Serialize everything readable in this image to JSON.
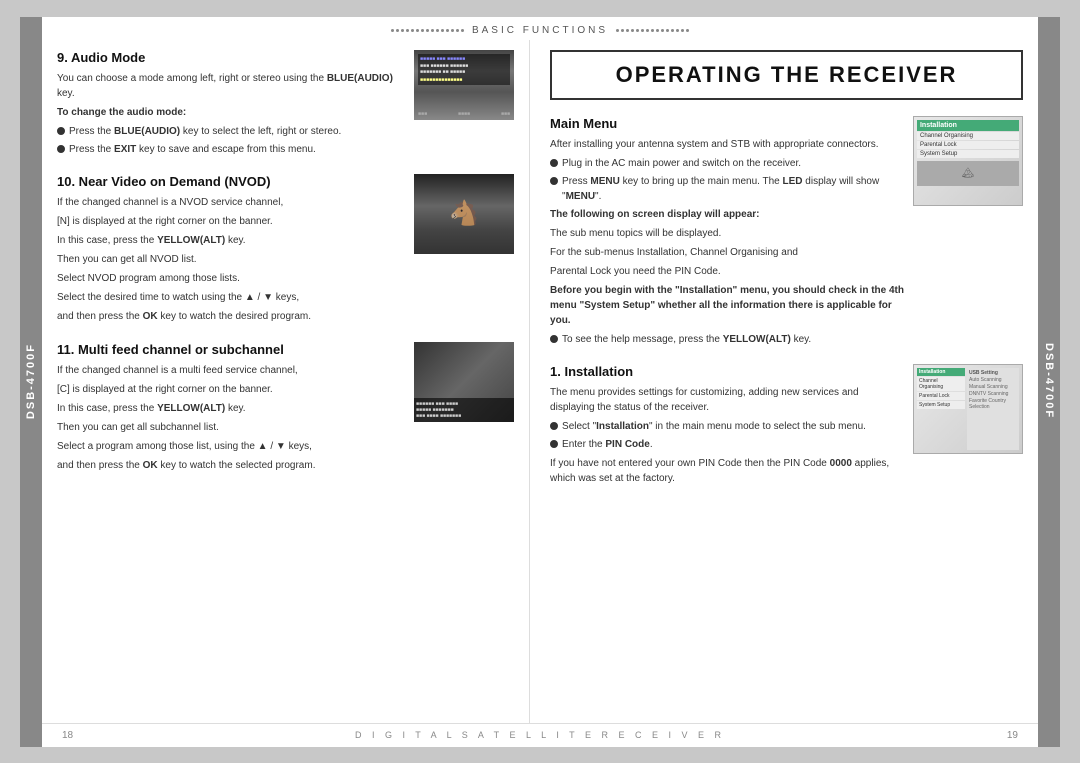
{
  "side_tabs": {
    "label": "DSB-4700F"
  },
  "header": {
    "left_dots": "• • • • • • • • • • • • • • •",
    "center_text": "BASIC FUNCTIONS",
    "right_dots": "• • • • • • • • • • • • • • •"
  },
  "right_title": "OPERATING THE RECEIVER",
  "left_sections": [
    {
      "id": "section9",
      "title": "9. Audio Mode",
      "paragraphs": [
        "You can choose a mode among left, right or stereo using the",
        "BLUE(AUDIO) key.",
        "To change the audio mode:",
        "Press the BLUE(AUDIO) key to select the left, right or stereo.",
        "Press the EXIT key to save and escape from this menu."
      ]
    },
    {
      "id": "section10",
      "title": "10. Near Video on Demand (NVOD)",
      "paragraphs": [
        "If the changed channel is a NVOD service channel,",
        "[N] is displayed at the right corner on the banner.",
        "In this case, press the YELLOW(ALT) key.",
        "Then you can get all NVOD list.",
        "Select NVOD program among those lists.",
        "Select the desired time to watch using the ▲ / ▼ keys,",
        "and then press the OK key to watch the desired program."
      ]
    },
    {
      "id": "section11",
      "title": "11. Multi feed channel or subchannel",
      "paragraphs": [
        "If the changed channel is a multi feed service channel,",
        "[C] is displayed at the right corner on the banner.",
        "In this case, press the YELLOW(ALT) key.",
        "Then you can get all subchannel list.",
        "Select a program among those list, using the ▲ / ▼ keys,",
        "and then press the OK key to watch the selected program."
      ]
    }
  ],
  "right_sections": [
    {
      "id": "main-menu",
      "title": "Main Menu",
      "intro": "After installing your antenna system and STB with appropriate connectors.",
      "bullets": [
        "Plug in the AC main power and switch on the receiver.",
        "Press MENU key to bring up the main menu. The LED display will show \"MENU\".",
        "The following on screen display will appear:",
        "The sub menu topics will be displayed. For the sub-menus Installation, Channel Organising and Parental Lock you need the PIN Code.",
        "Before you begin with the \"Installation\" menu, you should check in the 4th menu \"System Setup\" whether all the information there is applicable for you.",
        "To see the help message, press the YELLOW(ALT) key."
      ]
    },
    {
      "id": "installation",
      "title": "1. Installation",
      "intro": "The menu provides settings for customizing, adding new services and displaying the status of the receiver.",
      "bullets": [
        "Select \"Installation\" in the main menu mode to select the sub menu.",
        "Enter the PIN Code.",
        "If you have not entered your own PIN Code then the PIN Code 0000 applies, which was set at the factory."
      ]
    }
  ],
  "footer": {
    "left_page_num": "18",
    "center_text": "D I G I T A L   S A T E L L I T E   R E C E I V E R",
    "right_page_num": "19"
  }
}
